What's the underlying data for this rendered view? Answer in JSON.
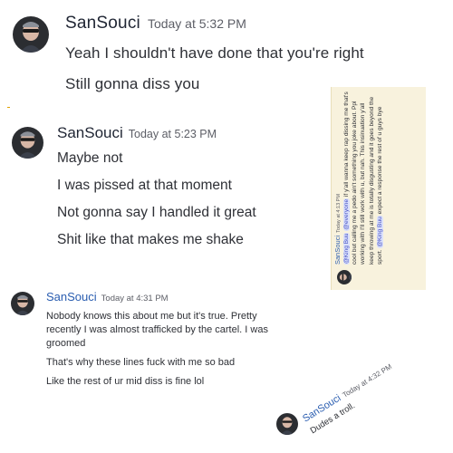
{
  "messages": [
    {
      "username": "SanSouci",
      "timestamp": "Today at 5:32 PM",
      "lines": [
        "Yeah I shouldn't have done that you're right",
        "Still gonna diss you"
      ]
    },
    {
      "username": "SanSouci",
      "timestamp": "Today at 5:23 PM",
      "lines": [
        "Maybe not",
        "I was pissed at that moment",
        "Not gonna say I handled it great",
        "Shit like that makes me shake"
      ]
    },
    {
      "username": "SanSouci",
      "timestamp": "Today at 4:31 PM",
      "lines": [
        "Nobody knows this about me but it's true. Pretty",
        "recently I was almost trafficked by the cartel. I was",
        "groomed",
        "That's why these lines fuck with me so bad",
        "Like the rest of ur mid diss is fine lol"
      ]
    }
  ],
  "rotated_panel": {
    "username": "SanSouci",
    "timestamp": "Today at 4:13 PM",
    "mention_1": "@King Buu",
    "mention_2": "@everyone",
    "text_1": " if y'all wanna keep rap dissing me that's cool but calling me a pedo ain't something you joke about. Ppl working with I'll still work with u, but nah. This insinuation y'all keep throwing at me is totally disgusting and it goes beyond the sport. ",
    "mention_3": "@King Buu",
    "text_2": " expect a response the rest of u guys bye"
  },
  "rotated_small": {
    "username": "SanSouci",
    "timestamp": "Today at 4:32 PM",
    "text": "Dudes a troll."
  },
  "colors": {
    "username": "#1f2533",
    "username_blue": "#2a5db0",
    "timestamp": "#5c5e66",
    "text": "#2e3036",
    "mention_bg": "#dbe1fb",
    "mention_text": "#4752c4",
    "panel_bg": "#f8f2dd"
  },
  "icons": {
    "avatar": "avatar-person-sunglasses"
  }
}
